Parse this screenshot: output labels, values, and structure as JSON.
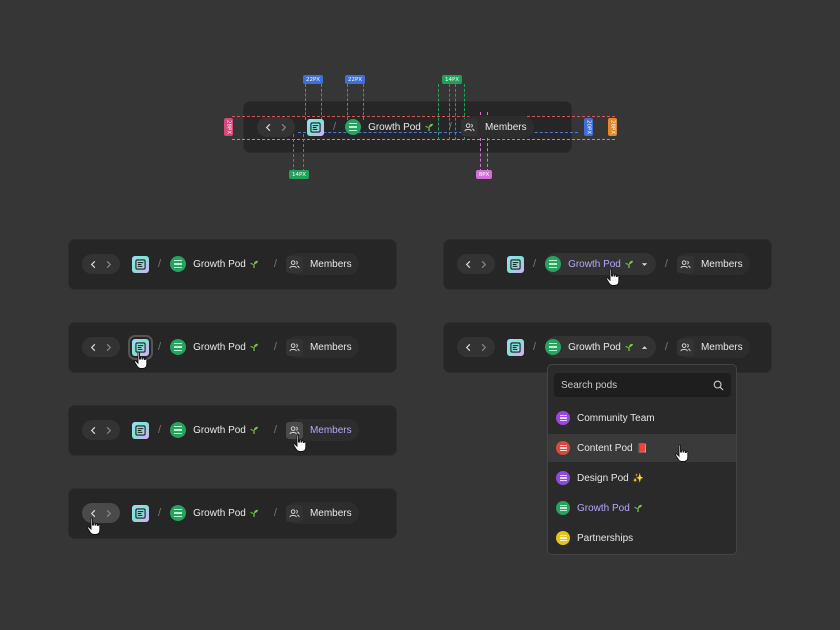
{
  "breadcrumb": {
    "pod_label": "Growth Pod",
    "members_label": "Members"
  },
  "spec": {
    "labels": [
      "22PX",
      "22PX",
      "14PX",
      "14PX",
      "8PX",
      "28PX",
      "28PX",
      "20PX"
    ]
  },
  "dropdown": {
    "search_placeholder": "Search pods",
    "items": [
      {
        "label": "Community Team",
        "color": "#9b45e4",
        "emoji": ""
      },
      {
        "label": "Content Pod",
        "color": "#d94a3d",
        "emoji": "📕"
      },
      {
        "label": "Design Pod",
        "color": "#8a4de0",
        "emoji": "✨"
      },
      {
        "label": "Growth Pod",
        "color": "#27a35f",
        "emoji": "🌱"
      },
      {
        "label": "Partnerships",
        "color": "#e8c21a",
        "emoji": ""
      }
    ]
  },
  "colors": {
    "background": "#363636",
    "card": "#262626",
    "accent": "#b9a6ff",
    "pod_green": "#27a35f"
  }
}
